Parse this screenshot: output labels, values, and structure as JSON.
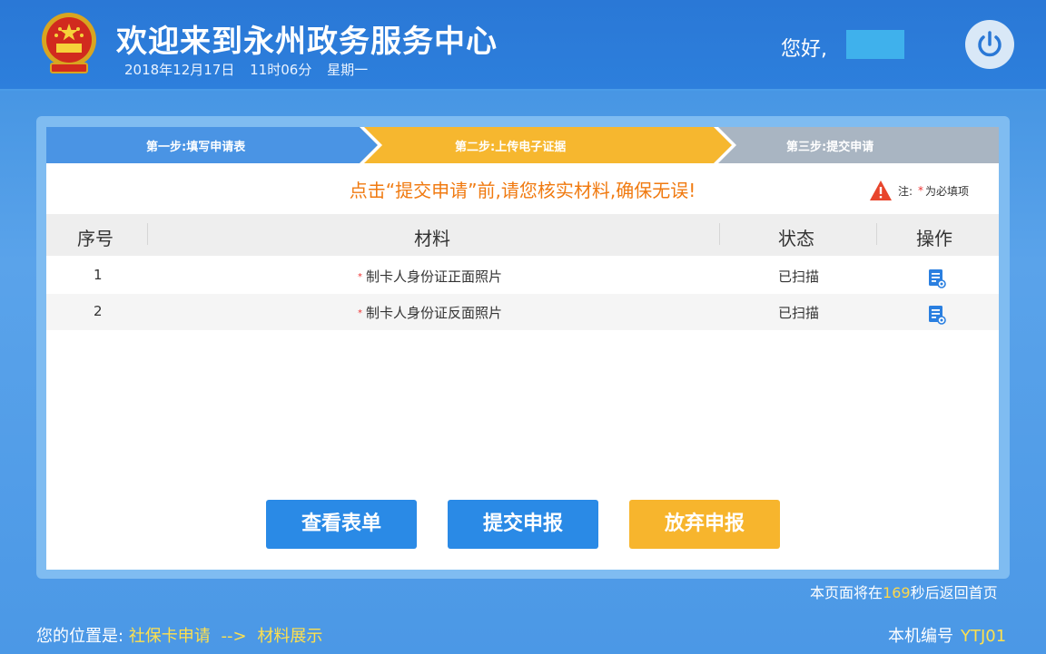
{
  "header": {
    "title": "欢迎来到永州政务服务中心",
    "date": "2018年12月17日",
    "time": "11时06分",
    "weekday": "星期一",
    "greeting": "您好,",
    "power_icon": "power-icon",
    "emblem_icon": "national-emblem"
  },
  "steps": [
    {
      "label": "第一步:填写申请表",
      "color": "#4a94e4"
    },
    {
      "label": "第二步:上传电子证据",
      "color": "#f6b72f"
    },
    {
      "label": "第三步:提交申请",
      "color": "#a9b5c2"
    }
  ],
  "notice": "点击“提交申请”前,请您核实材料,确保无误!",
  "required_note": {
    "prefix": "注:",
    "star": "*",
    "text": "为必填项",
    "icon": "warning-icon"
  },
  "table": {
    "headers": [
      "序号",
      "材料",
      "状态",
      "操作"
    ],
    "rows": [
      {
        "index": "1",
        "star": "*",
        "material": "制卡人身份证正面照片",
        "status": "已扫描",
        "action_icon": "document-view-icon"
      },
      {
        "index": "2",
        "star": "*",
        "material": "制卡人身份证反面照片",
        "status": "已扫描",
        "action_icon": "document-view-icon"
      }
    ]
  },
  "buttons": {
    "view_form": "查看表单",
    "submit": "提交申报",
    "abandon": "放弃申报"
  },
  "countdown": {
    "prefix": "本页面将在",
    "seconds": "169",
    "suffix": "秒后返回首页"
  },
  "location": {
    "prefix": "您的位置是:",
    "crumb1": "社保卡申请",
    "arrow": "-->",
    "crumb2": "材料展示"
  },
  "machine": {
    "label": "本机编号",
    "code": "YTJ01"
  },
  "colors": {
    "header_bg": "#2a78d6",
    "step_active": "#f6b72f",
    "notice_text": "#f07a10",
    "button_blue": "#2a8ae6",
    "button_orange": "#f7b52d",
    "highlight_yellow": "#ffe04d"
  }
}
